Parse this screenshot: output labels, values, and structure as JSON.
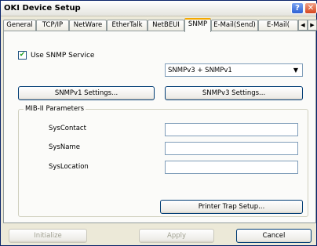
{
  "window": {
    "title": "OKI Device Setup"
  },
  "titlebar": {
    "help_glyph": "?",
    "close_glyph": "✕"
  },
  "tabs": [
    {
      "label": "General"
    },
    {
      "label": "TCP/IP"
    },
    {
      "label": "NetWare"
    },
    {
      "label": "EtherTalk"
    },
    {
      "label": "NetBEUI"
    },
    {
      "label": "SNMP"
    },
    {
      "label": "E-Mail(Send)"
    },
    {
      "label": "E-Mail("
    }
  ],
  "active_tab": "SNMP",
  "tab_scroll": {
    "left": "◀",
    "right": "▶"
  },
  "snmp": {
    "use_service_label": "Use SNMP Service",
    "use_service_checked": true,
    "check_glyph": "✔",
    "version_select": {
      "value": "SNMPv3 + SNMPv1",
      "arrow": "▼"
    },
    "v1_settings_label": "SNMPv1 Settings...",
    "v3_settings_label": "SNMPv3 Settings..."
  },
  "mib": {
    "group_label": "MIB-II Parameters",
    "fields": [
      {
        "label": "SysContact",
        "value": ""
      },
      {
        "label": "SysName",
        "value": ""
      },
      {
        "label": "SysLocation",
        "value": ""
      }
    ],
    "printer_trap_label": "Printer Trap Setup..."
  },
  "footer": {
    "initialize_label": "Initialize",
    "apply_label": "Apply",
    "cancel_label": "Cancel"
  }
}
